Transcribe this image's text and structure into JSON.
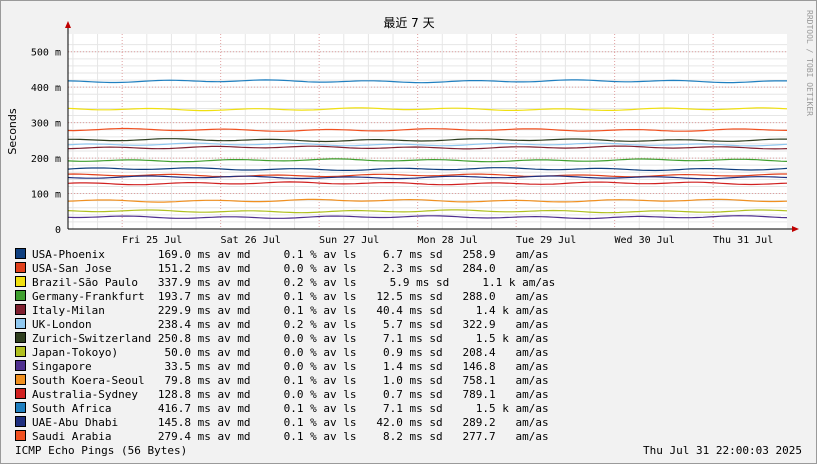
{
  "chart_data": {
    "type": "line",
    "title": "最近 7 天",
    "ylabel": "Seconds",
    "ylim": [
      0,
      0.55
    ],
    "ytick_labels": [
      "0",
      "100 m",
      "200 m",
      "300 m",
      "400 m",
      "500 m"
    ],
    "xtick_labels": [
      "Fri 25 Jul",
      "Sat 26 Jul",
      "Sun 27 Jul",
      "Mon 28 Jul",
      "Tue 29 Jul",
      "Wed 30 Jul",
      "Thu 31 Jul"
    ],
    "grid": true,
    "side_label": "RRDTOOL / TOBI OETIKER",
    "series": [
      {
        "name": "USA-Phoenix",
        "color": "#0f3f7f",
        "value": 0.169
      },
      {
        "name": "USA-San Jose",
        "color": "#e0401c",
        "value": 0.1512
      },
      {
        "name": "Brazil-São Paulo",
        "color": "#f0e010",
        "value": 0.3379
      },
      {
        "name": "Germany-Frankfurt",
        "color": "#3f9f2f",
        "value": 0.1937
      },
      {
        "name": "Italy-Milan",
        "color": "#7f1f2f",
        "value": 0.2299
      },
      {
        "name": "UK-London",
        "color": "#90c8f0",
        "value": 0.2384
      },
      {
        "name": "Zurich-Switzerland",
        "color": "#2f3f1f",
        "value": 0.2508
      },
      {
        "name": "Japan-Tokoyo)",
        "color": "#b0c020",
        "value": 0.05
      },
      {
        "name": "Singapore",
        "color": "#4f2f8f",
        "value": 0.0335
      },
      {
        "name": "South Koera-Seoul",
        "color": "#f09020",
        "value": 0.0798
      },
      {
        "name": "Australia-Sydney",
        "color": "#d02020",
        "value": 0.1288
      },
      {
        "name": "South Africa",
        "color": "#1f7fbf",
        "value": 0.4167
      },
      {
        "name": "UAE-Abu Dhabi",
        "color": "#1f2f7f",
        "value": 0.1458
      },
      {
        "name": "Saudi Arabia",
        "color": "#f05020",
        "value": 0.2794
      }
    ]
  },
  "legend": [
    {
      "name": "USA-Phoenix",
      "text": "        169.0 ms av md     0.1 % av ls    6.7 ms sd   258.9   am/as"
    },
    {
      "name": "USA-San Jose",
      "text": "       151.2 ms av md     0.0 % av ls    2.3 ms sd   284.0   am/as"
    },
    {
      "name": "Brazil-São Paulo",
      "text": "   337.9 ms av md     0.2 % av ls     5.9 ms sd     1.1 k am/as"
    },
    {
      "name": "Germany-Frankfurt",
      "text": "  193.7 ms av md     0.1 % av ls   12.5 ms sd   288.0   am/as"
    },
    {
      "name": "Italy-Milan",
      "text": "        229.9 ms av md     0.1 % av ls   40.4 ms sd     1.4 k am/as"
    },
    {
      "name": "UK-London",
      "text": "          238.4 ms av md     0.2 % av ls    5.7 ms sd   322.9   am/as"
    },
    {
      "name": "Zurich-Switzerland",
      "text": " 250.8 ms av md     0.0 % av ls    7.1 ms sd     1.5 k am/as"
    },
    {
      "name": "Japan-Tokoyo)",
      "text": "       50.0 ms av md     0.0 % av ls    0.9 ms sd   208.4   am/as"
    },
    {
      "name": "Singapore",
      "text": "           33.5 ms av md     0.0 % av ls    1.4 ms sd   146.8   am/as"
    },
    {
      "name": "South Koera-Seoul",
      "text": "   79.8 ms av md     0.1 % av ls    1.0 ms sd   758.1   am/as"
    },
    {
      "name": "Australia-Sydney",
      "text": "   128.8 ms av md     0.0 % av ls    0.7 ms sd   789.1   am/as"
    },
    {
      "name": "South Africa",
      "text": "       416.7 ms av md     0.1 % av ls    7.1 ms sd     1.5 k am/as"
    },
    {
      "name": "UAE-Abu Dhabi",
      "text": "      145.8 ms av md     0.1 % av ls   42.0 ms sd   289.2   am/as"
    },
    {
      "name": "Saudi Arabia",
      "text": "       279.4 ms av md     0.1 % av ls    8.2 ms sd   277.7   am/as"
    }
  ],
  "footer": {
    "left": "ICMP Echo Pings (56 Bytes)",
    "right": "Thu Jul 31 22:00:03 2025"
  }
}
